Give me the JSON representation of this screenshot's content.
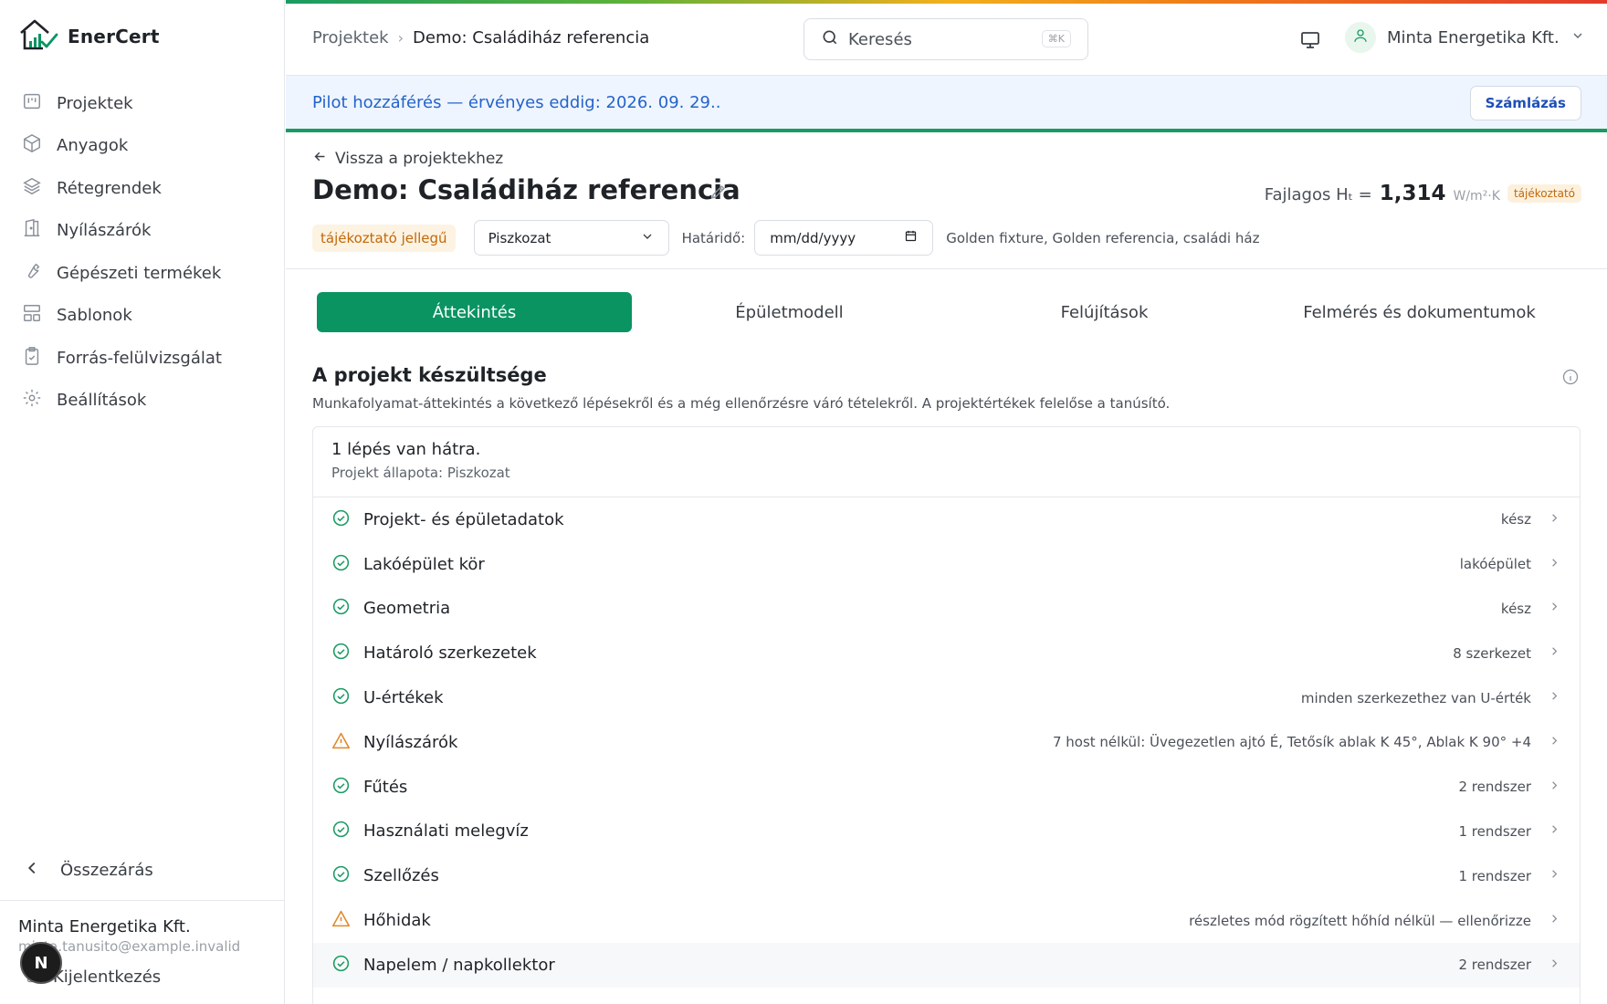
{
  "brand": {
    "name": "EnerCert"
  },
  "sidebar": {
    "items": [
      {
        "label": "Projektek",
        "icon": "kanban-icon"
      },
      {
        "label": "Anyagok",
        "icon": "box-icon"
      },
      {
        "label": "Rétegrendek",
        "icon": "layers-icon"
      },
      {
        "label": "Nyílászárók",
        "icon": "door-icon"
      },
      {
        "label": "Gépészeti termékek",
        "icon": "wrench-icon"
      },
      {
        "label": "Sablonok",
        "icon": "template-icon"
      },
      {
        "label": "Forrás-felülvizsgálat",
        "icon": "clipboard-check-icon"
      },
      {
        "label": "Beállítások",
        "icon": "gear-icon"
      }
    ],
    "collapse_label": "Összezárás",
    "org_name": "Minta Energetika Kft.",
    "org_email": "minta.tanusito@example.invalid",
    "logout_label": "Kijelentkezés",
    "badge_letter": "N"
  },
  "topbar": {
    "breadcrumb_root": "Projektek",
    "breadcrumb_current": "Demo: Családiház referencia",
    "search_placeholder": "Keresés",
    "search_shortcut": "⌘K",
    "user_name": "Minta Energetika Kft."
  },
  "banner": {
    "text": "Pilot hozzáférés — érvényes eddig: 2026. 09. 29..",
    "billing_label": "Számlázás"
  },
  "project": {
    "back_label": "Vissza a projektekhez",
    "title": "Demo: Családiház referencia",
    "metric_label": "Fajlagos Hₜ =",
    "metric_value": "1,314",
    "metric_unit": "W/m²·K",
    "metric_badge": "tájékoztató",
    "info_badge": "tájékoztató jellegű",
    "status_value": "Piszkozat",
    "deadline_label": "Határidő:",
    "deadline_placeholder": "mm/dd/yyyy",
    "tags": "Golden fixture, Golden referencia, családi ház"
  },
  "tabs": [
    {
      "label": "Áttekintés",
      "active": true
    },
    {
      "label": "Épületmodell",
      "active": false
    },
    {
      "label": "Felújítások",
      "active": false
    },
    {
      "label": "Felmérés és dokumentumok",
      "active": false
    }
  ],
  "progress": {
    "title": "A projekt készültsége",
    "description": "Munkafolyamat-áttekintés a következő lépésekről és a még ellenőrzésre váró tételekről. A projektértékek felelőse a tanúsító.",
    "steps_left": "1 lépés van hátra.",
    "project_status": "Projekt állapota: Piszkozat",
    "steps": [
      {
        "name": "Projekt- és épületadatok",
        "value": "kész",
        "state": "ok"
      },
      {
        "name": "Lakóépület kör",
        "value": "lakóépület",
        "state": "ok"
      },
      {
        "name": "Geometria",
        "value": "kész",
        "state": "ok"
      },
      {
        "name": "Határoló szerkezetek",
        "value": "8 szerkezet",
        "state": "ok"
      },
      {
        "name": "U-értékek",
        "value": "minden szerkezethez van U-érték",
        "state": "ok"
      },
      {
        "name": "Nyílászárók",
        "value": "7 host nélkül: Üvegezetlen ajtó É, Tetősík ablak K 45°, Ablak K 90° +4",
        "state": "warning"
      },
      {
        "name": "Fűtés",
        "value": "2 rendszer",
        "state": "ok"
      },
      {
        "name": "Használati melegvíz",
        "value": "1 rendszer",
        "state": "ok"
      },
      {
        "name": "Szellőzés",
        "value": "1 rendszer",
        "state": "ok"
      },
      {
        "name": "Hőhidak",
        "value": "részletes mód rögzített hőhíd nélkül — ellenőrizze",
        "state": "warning"
      },
      {
        "name": "Napelem / napkollektor",
        "value": "2 rendszer",
        "state": "ok"
      }
    ]
  },
  "colors": {
    "accent_green": "#0a9462",
    "ok_green": "#1a9b63",
    "warning_orange": "#e0892a",
    "banner_blue": "#2563c9",
    "badge_orange": "#c2680a"
  }
}
